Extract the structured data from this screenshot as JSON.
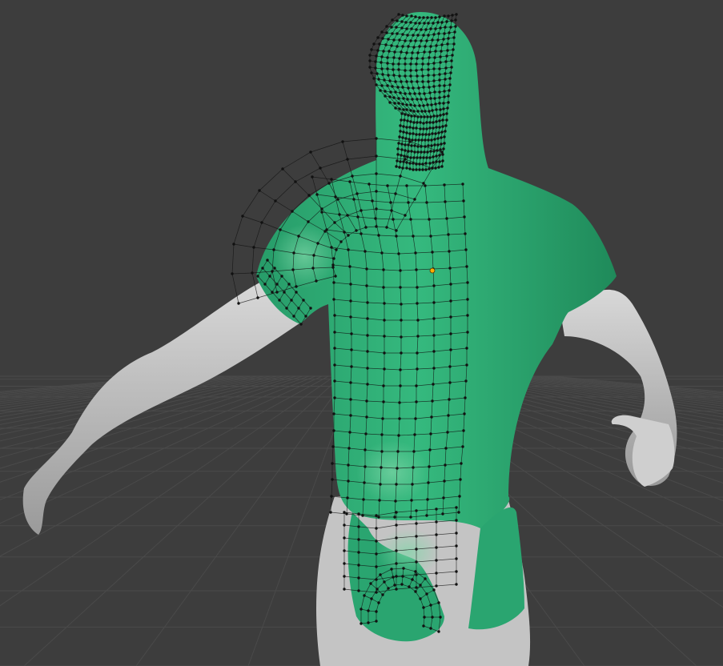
{
  "viewport": {
    "background_color": "#3d3d3d",
    "grid_color": "#4a4a4a",
    "model": {
      "body_color": "#c9c9c9",
      "body_shadow_color": "#8f8f8f",
      "selected_face_color": "#2fb379",
      "selected_face_dark_color": "#1f8a5a",
      "wire_vertex_color": "#111111",
      "active_vertex_color": "#ffae00"
    },
    "icons": {
      "active_vertex": "active-vertex-icon"
    }
  }
}
